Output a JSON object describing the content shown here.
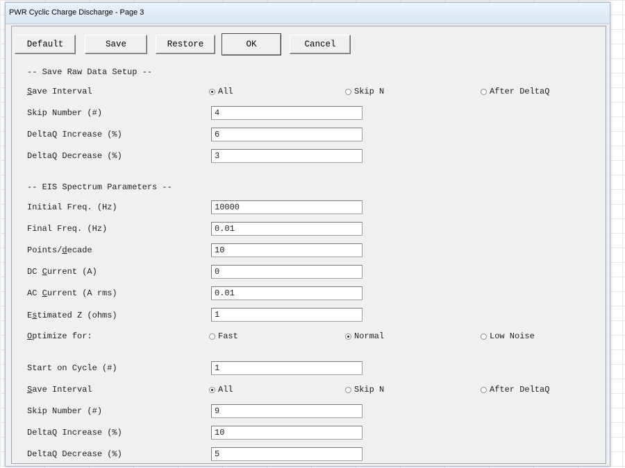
{
  "window": {
    "title": "PWR Cyclic Charge Discharge - Page 3"
  },
  "buttons": [
    {
      "pre": "",
      "key": "D",
      "post": "efault"
    },
    {
      "pre": "",
      "key": "S",
      "post": "ave"
    },
    {
      "pre": "",
      "key": "R",
      "post": "estore"
    },
    {
      "pre": "",
      "key": "O",
      "post": "K"
    },
    {
      "pre": "",
      "key": "C",
      "post": "ancel"
    }
  ],
  "section1": {
    "title": "-- Save Raw Data Setup --"
  },
  "save_interval_1": {
    "label_key": "S",
    "label_post": "ave Interval",
    "options": [
      "All",
      "Skip N",
      "After DeltaQ"
    ],
    "selected": 0
  },
  "skip_number_1": {
    "label": "Skip Number (#)",
    "value": "4"
  },
  "deltaq_increase_1": {
    "label": "DeltaQ Increase (%)",
    "value": "6"
  },
  "deltaq_decrease_1": {
    "label": "DeltaQ Decrease (%)",
    "value": "3"
  },
  "section2": {
    "title": "-- EIS Spectrum Parameters --"
  },
  "initial_freq": {
    "label": "Initial Freq. (Hz)",
    "value": "10000"
  },
  "final_freq": {
    "label": "Final Freq. (Hz)",
    "value": "0.01"
  },
  "points_decade": {
    "label_pre": "Points/",
    "label_key": "d",
    "label_post": "ecade",
    "value": "10"
  },
  "dc_current": {
    "label_pre": "DC ",
    "label_key": "C",
    "label_post": "urrent (A)",
    "value": "0"
  },
  "ac_current": {
    "label_pre": "AC ",
    "label_key": "C",
    "label_post": "urrent (A rms)",
    "value": "0.01"
  },
  "estimated_z": {
    "label_pre": "E",
    "label_key": "s",
    "label_post": "timated Z (ohms)",
    "value": "1"
  },
  "optimize": {
    "label_key": "O",
    "label_post": "ptimize for:",
    "options": [
      "Fast",
      "Normal",
      "Low Noise"
    ],
    "selected": 1
  },
  "start_cycle": {
    "label": "Start on Cycle (#)",
    "value": "1"
  },
  "save_interval_2": {
    "label_key": "S",
    "label_post": "ave Interval",
    "options": [
      "All",
      "Skip N",
      "After DeltaQ"
    ],
    "selected": 0
  },
  "skip_number_2": {
    "label": "Skip Number (#)",
    "value": "9"
  },
  "deltaq_increase_2": {
    "label": "DeltaQ Increase (%)",
    "value": "10"
  },
  "deltaq_decrease_2": {
    "label": "DeltaQ Decrease (%)",
    "value": "5"
  }
}
